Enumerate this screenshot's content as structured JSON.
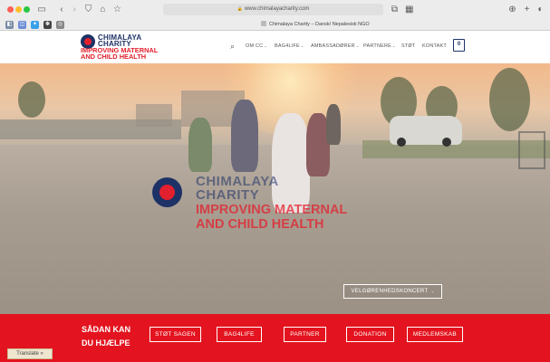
{
  "browser": {
    "url": "www.chimalayacharity.com",
    "tab_title": "Chimalaya Charity – Dansk/ Nepalesisk NGO",
    "icons": [
      "sidebar-icon",
      "back-icon",
      "forward-icon",
      "shield-icon",
      "home-icon",
      "star-icon",
      "tabs-icon",
      "grid-icon",
      "download-icon",
      "new-tab-icon",
      "share-icon"
    ]
  },
  "site": {
    "logo_line1": "CHIMALAYA",
    "logo_line2": "CHARITY",
    "logo_line3": "IMPROVING MATERNAL",
    "logo_line4": "AND CHILD HEALTH",
    "nav": [
      {
        "label": "OM CC"
      },
      {
        "label": "BAG4LIFE"
      },
      {
        "label": "AMBASSADØRER"
      },
      {
        "label": "PARTNERE"
      },
      {
        "label": "STØT"
      },
      {
        "label": "KONTAKT"
      }
    ],
    "cart_count": "0"
  },
  "hero": {
    "line1": "CHIMALAYA",
    "line2": "CHARITY",
    "line3": "IMPROVING MATERNAL",
    "line4": "AND CHILD HEALTH",
    "concert_button": "VELGØRENHEDSKONCERT"
  },
  "band": {
    "title_line1": "SÅDAN KAN",
    "title_line2": "DU HJÆLPE",
    "buttons": [
      "STØT SAGEN",
      "BAG4LIFE",
      "PARTNER",
      "DONATION",
      "MEDLEMSKAB"
    ]
  },
  "translate_label": "Translate »",
  "colors": {
    "navy": "#1d3266",
    "red": "#e3202d",
    "band_red": "#e3141f"
  }
}
